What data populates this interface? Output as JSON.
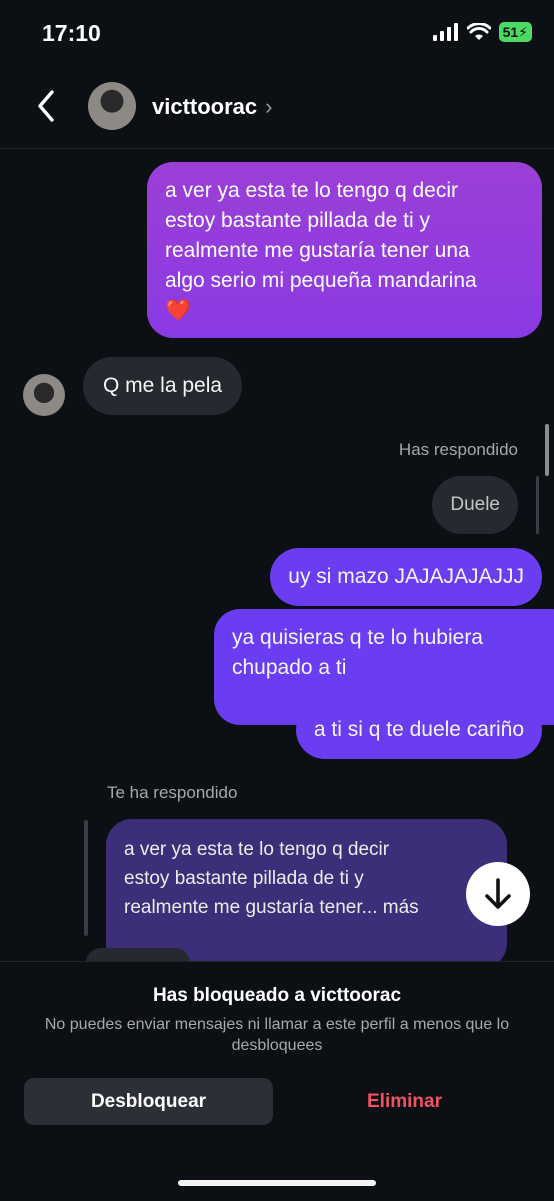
{
  "status_bar": {
    "time": "17:10",
    "battery": "51"
  },
  "header": {
    "username": "victtoorac"
  },
  "messages": {
    "sent_1": "a ver ya esta te lo tengo q decir\nestoy bastante pillada de ti y\nrealmente me gustaría tener una\nalgo serio mi pequeña mandarina\n❤️",
    "received_1": "Q me la pela",
    "you_replied_label": "Has respondido",
    "replied_to": "Duele",
    "sent_2": "uy si mazo JAJAJAJAJJJ",
    "sent_3": "ya quisieras q te lo hubiera\nchupado a ti",
    "sent_4": "a ti si q te duele cariño",
    "they_replied_label": "Te ha respondido",
    "quoted_reply": "a ver ya esta te lo tengo q decir\nestoy bastante pillada de ti y\nrealmente me gustaría tener... más"
  },
  "blocked_panel": {
    "title": "Has bloqueado a victtoorac",
    "subtitle": "No puedes enviar mensajes ni llamar a este perfil a menos que lo desbloquees",
    "unblock_label": "Desbloquear",
    "delete_label": "Eliminar"
  },
  "colors": {
    "sent_bubble": "#6b3df0",
    "received_bubble": "#262a30",
    "delete_text": "#ef5360"
  },
  "icons": {
    "back": "chevron-left-icon",
    "scroll_down": "arrow-down-icon",
    "signal": "cellular-signal-icon",
    "wifi": "wifi-icon",
    "battery": "battery-charging-icon"
  }
}
